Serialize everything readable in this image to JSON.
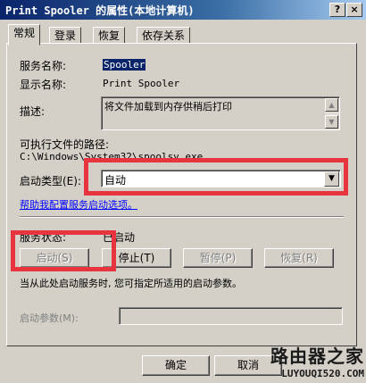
{
  "window": {
    "title": "Print Spooler 的属性(本地计算机)",
    "help_button": "?",
    "close_button": "×"
  },
  "tabs": [
    {
      "label": "常规",
      "active": true
    },
    {
      "label": "登录",
      "active": false
    },
    {
      "label": "恢复",
      "active": false
    },
    {
      "label": "依存关系",
      "active": false
    }
  ],
  "general": {
    "service_name_label": "服务名称:",
    "service_name_value": "Spooler",
    "display_name_label": "显示名称:",
    "display_name_value": "Print Spooler",
    "description_label": "描述:",
    "description_value": "将文件加载到内存供稍后打印",
    "exe_path_label": "可执行文件的路径:",
    "exe_path_value": "C:\\Windows\\System32\\spoolsv.exe",
    "startup_type_label": "启动类型(E):",
    "startup_type_value": "自动",
    "help_link": "帮助我配置服务启动选项。",
    "service_status_label": "服务状态:",
    "service_status_value": "已启动",
    "start_hint": "当从此处启动服务时, 您可指定所适用的启动参数。",
    "start_params_label": "启动参数(M):",
    "start_params_value": ""
  },
  "service_buttons": {
    "start": "启动(S)",
    "stop": "停止(T)",
    "pause": "暂停(P)",
    "resume": "恢复(R)"
  },
  "footer_buttons": {
    "ok": "确定",
    "cancel": "取消"
  },
  "watermark": {
    "logo_text": "路由器之家",
    "url": "LUYOUQI520.COM"
  },
  "colors": {
    "highlight": "#e8343e",
    "titlebar": "#0a246a",
    "dialog": "#d4d0c8"
  }
}
